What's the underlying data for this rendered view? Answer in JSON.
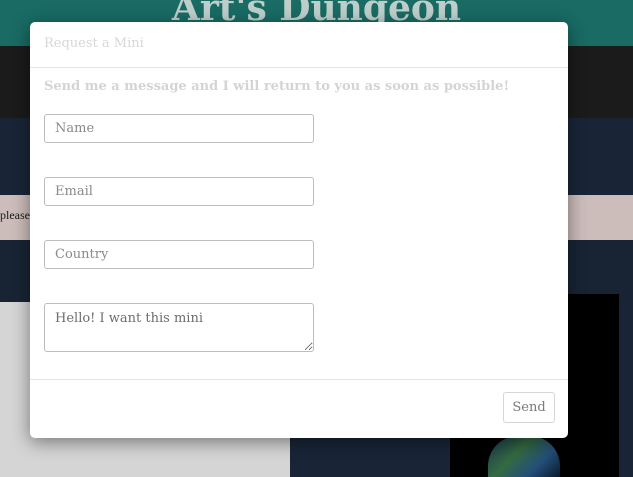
{
  "background": {
    "site_title": "Art's Dungeon",
    "alert_text": "please"
  },
  "modal": {
    "title": "Request a Mini",
    "subtitle": "Send me a message and I will return to you as soon as possible!",
    "fields": {
      "name_placeholder": "Name",
      "email_placeholder": "Email",
      "country_placeholder": "Country",
      "message_placeholder": "Hello! I want this mini"
    },
    "send_label": "Send"
  }
}
